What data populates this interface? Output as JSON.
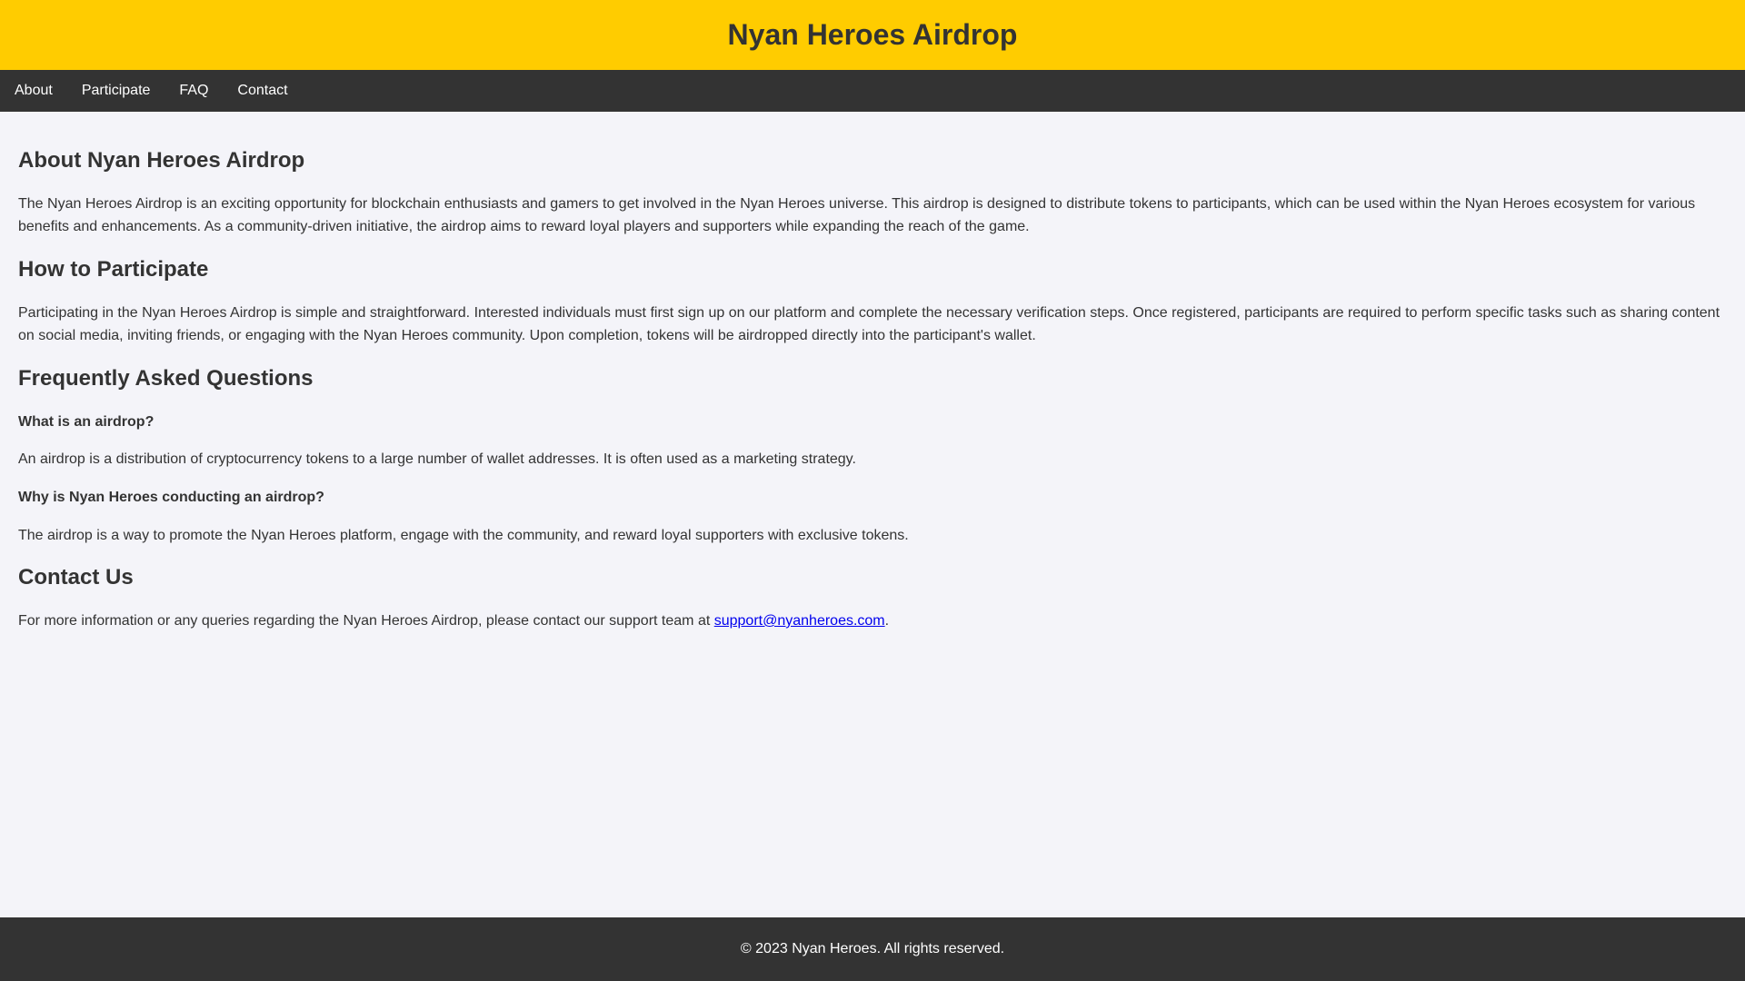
{
  "header": {
    "title": "Nyan Heroes Airdrop"
  },
  "nav": [
    {
      "label": "About"
    },
    {
      "label": "Participate"
    },
    {
      "label": "FAQ"
    },
    {
      "label": "Contact"
    }
  ],
  "about": {
    "heading": "About Nyan Heroes Airdrop",
    "text": "The Nyan Heroes Airdrop is an exciting opportunity for blockchain enthusiasts and gamers to get involved in the Nyan Heroes universe. This airdrop is designed to distribute tokens to participants, which can be used within the Nyan Heroes ecosystem for various benefits and enhancements. As a community-driven initiative, the airdrop aims to reward loyal players and supporters while expanding the reach of the game."
  },
  "participate": {
    "heading": "How to Participate",
    "text": "Participating in the Nyan Heroes Airdrop is simple and straightforward. Interested individuals must first sign up on our platform and complete the necessary verification steps. Once registered, participants are required to perform specific tasks such as sharing content on social media, inviting friends, or engaging with the Nyan Heroes community. Upon completion, tokens will be airdropped directly into the participant's wallet."
  },
  "faq": {
    "heading": "Frequently Asked Questions",
    "items": [
      {
        "q": "What is an airdrop?",
        "a": "An airdrop is a distribution of cryptocurrency tokens to a large number of wallet addresses. It is often used as a marketing strategy."
      },
      {
        "q": "Why is Nyan Heroes conducting an airdrop?",
        "a": "The airdrop is a way to promote the Nyan Heroes platform, engage with the community, and reward loyal supporters with exclusive tokens."
      }
    ]
  },
  "contact": {
    "heading": "Contact Us",
    "text": "For more information or any queries regarding the Nyan Heroes Airdrop, please contact our support team at ",
    "email": "support@nyanheroes.com",
    "suffix": "."
  },
  "footer": {
    "text": "© 2023 Nyan Heroes. All rights reserved."
  }
}
